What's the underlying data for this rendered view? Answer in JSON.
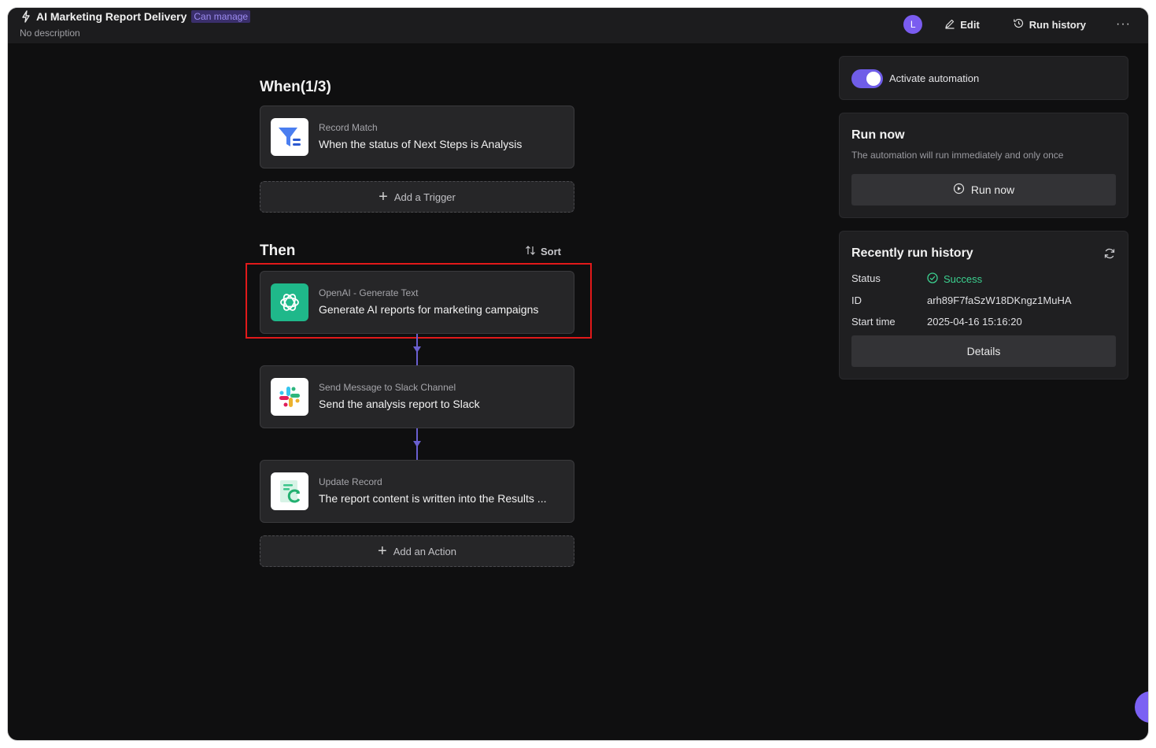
{
  "header": {
    "title": "AI Marketing Report Delivery",
    "badge": "Can manage",
    "description": "No description",
    "avatar_letter": "L",
    "edit_label": "Edit",
    "run_history_label": "Run history",
    "more_label": "···"
  },
  "when": {
    "heading": "When(1/3)",
    "trigger": {
      "kind": "Record Match",
      "text": "When the status of Next Steps is Analysis",
      "icon": "filter-icon"
    },
    "add_trigger_label": "Add a Trigger"
  },
  "then": {
    "heading": "Then",
    "sort_label": "Sort",
    "actions": [
      {
        "kind": "OpenAI - Generate Text",
        "text": "Generate AI reports for marketing campaigns",
        "icon": "openai-icon"
      },
      {
        "kind": "Send Message to Slack Channel",
        "text": "Send the analysis report to Slack",
        "icon": "slack-icon"
      },
      {
        "kind": "Update Record",
        "text": "The report content is written into the Results ...",
        "icon": "update-record-icon"
      }
    ],
    "add_action_label": "Add an Action"
  },
  "side": {
    "activate_label": "Activate automation",
    "activated": true,
    "run_now": {
      "heading": "Run now",
      "description": "The automation will run immediately and only once",
      "button_label": "Run now"
    },
    "history": {
      "heading": "Recently run history",
      "status_label": "Status",
      "status_value": "Success",
      "id_label": "ID",
      "id_value": "arh89F7faSzW18DKngz1MuHA",
      "start_label": "Start time",
      "start_value": "2025-04-16 15:16:20",
      "details_label": "Details"
    }
  },
  "colors": {
    "accent": "#6f5de8",
    "success": "#3bd08f",
    "highlight": "#e1191a",
    "openai": "#1fb88a"
  }
}
